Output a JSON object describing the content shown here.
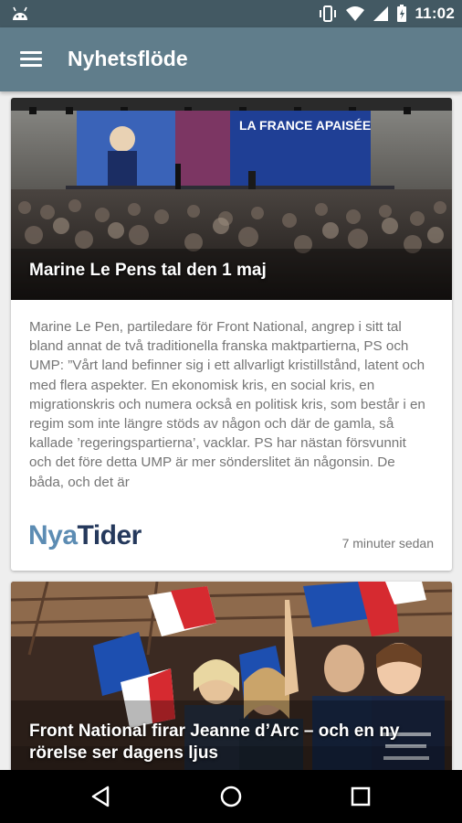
{
  "status_bar": {
    "time": "11:02",
    "icons": [
      "android-icon",
      "vibrate-icon",
      "wifi-icon",
      "signal-icon",
      "battery-icon"
    ]
  },
  "app_bar": {
    "title": "Nyhetsflöde",
    "menu_icon": "hamburger-menu-icon"
  },
  "feed": {
    "articles": [
      {
        "headline": "Marine Le Pens tal den 1 maj",
        "image_banner_text": "LA FRANCE APAISÉE",
        "excerpt": "Marine Le Pen, partiledare för Front National, angrep i sitt tal bland annat de två traditionella franska maktpartierna, PS och UMP: ”Vårt land befinner sig i ett allvarligt kristillstånd, latent och med flera aspekter. En ekonomisk kris, en social kris, en migrationskris och numera också en politisk kris, som består i en regim som inte längre stöds av någon och där de gamla, så kallade ’regeringspartierna’, vacklar. PS har nästan försvunnit och det före detta UMP är mer sönderslitet än någonsin. De båda, och det är",
        "source": {
          "part1": "Nya",
          "part2": "Tider"
        },
        "timestamp": "7 minuter sedan"
      },
      {
        "headline": "Front National firar Jeanne d’Arc – och en ny rörelse ser dagens ljus"
      }
    ]
  },
  "nav_bar": {
    "icons": [
      "back-icon",
      "home-icon",
      "recents-icon"
    ]
  },
  "colors": {
    "status_bar": "#435963",
    "app_bar": "#607d8b",
    "background": "#eeeeee",
    "logo_nya": "#5c8cb3",
    "logo_tider": "#25395c"
  }
}
